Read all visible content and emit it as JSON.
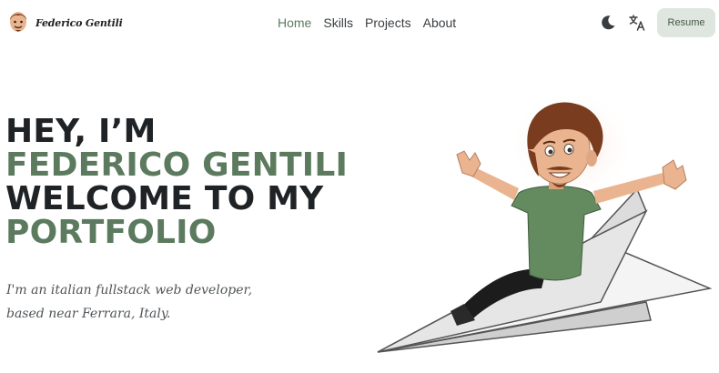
{
  "navbar": {
    "brand_name": "Federico Gentili",
    "links": [
      {
        "label": "Home",
        "active": true
      },
      {
        "label": "Skills",
        "active": false
      },
      {
        "label": "Projects",
        "active": false
      },
      {
        "label": "About",
        "active": false
      }
    ],
    "theme_icon": "moon-icon",
    "language_icon": "translate-icon",
    "resume_label": "Resume"
  },
  "hero": {
    "lines": [
      "HEY, I’M",
      "FEDERICO GENTILI",
      "WELCOME TO MY",
      "PORTFOLIO"
    ],
    "subtitle": "I'm an italian fullstack web developer, based near Ferrara, Italy."
  },
  "colors": {
    "accent": "#5b7a5e",
    "text_dark": "#1f2326",
    "button_bg": "#dfe6df"
  }
}
